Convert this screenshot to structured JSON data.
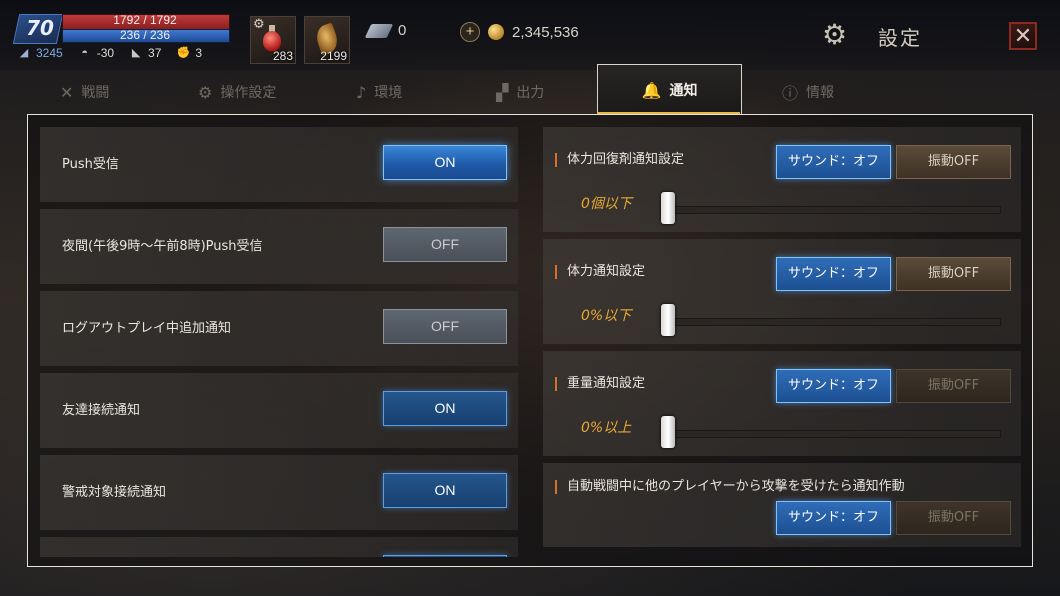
{
  "hud": {
    "level": "70",
    "hp": "1792 / 1792",
    "mp": "236 / 236",
    "stats": [
      {
        "icon": "wing-icon",
        "value": "3245"
      },
      {
        "icon": "helmet-icon",
        "value": "-30"
      },
      {
        "icon": "boot-icon",
        "value": "37"
      },
      {
        "icon": "fist-icon",
        "value": "3"
      }
    ],
    "items": [
      {
        "icon": "hp-potion-icon",
        "qty": "283"
      },
      {
        "icon": "feather-icon",
        "qty": "2199"
      }
    ],
    "wing_currency": "0",
    "gold": "2,345,536",
    "settings_title": "設定",
    "close_symbol": "✕"
  },
  "tabs": [
    {
      "icon": "swords-icon",
      "label": "戦闘"
    },
    {
      "icon": "gear-icon",
      "label": "操作設定"
    },
    {
      "icon": "music-note-icon",
      "label": "環境"
    },
    {
      "icon": "output-icon",
      "label": "出力"
    },
    {
      "icon": "bell-icon",
      "label": "通知",
      "active": true
    },
    {
      "icon": "info-icon",
      "label": "情報"
    }
  ],
  "left_options": [
    {
      "label": "Push受信",
      "state": "ON"
    },
    {
      "label": "夜間(午後9時～午前8時)Push受信",
      "state": "OFF"
    },
    {
      "label": "ログアウトプレイ中追加通知",
      "state": "OFF"
    },
    {
      "label": "友達接続通知",
      "state": "ON"
    },
    {
      "label": "警戒対象接続通知",
      "state": "ON"
    }
  ],
  "right_options": [
    {
      "label": "体力回復剤通知設定",
      "sound": "サウンド：オフ",
      "vibration": "振動OFF",
      "slider_label": "0個以下",
      "slider_value": 0
    },
    {
      "label": "体力通知設定",
      "sound": "サウンド：オフ",
      "vibration": "振動OFF",
      "slider_label": "0%以下",
      "slider_value": 0
    },
    {
      "label": "重量通知設定",
      "sound": "サウンド：オフ",
      "vibration": "振動OFF",
      "slider_label": "0%以上",
      "slider_value": 0
    },
    {
      "label": "自動戦闘中に他のプレイヤーから攻撃を受けたら通知作動",
      "sound": "サウンド：オフ",
      "vibration": "振動OFF"
    }
  ],
  "colors": {
    "on_button": "#1f5aa8",
    "off_button": "#4a5058",
    "accent_gold": "#e8b84a",
    "slider_text": "#e8a832",
    "close_border": "#8c2a22"
  }
}
